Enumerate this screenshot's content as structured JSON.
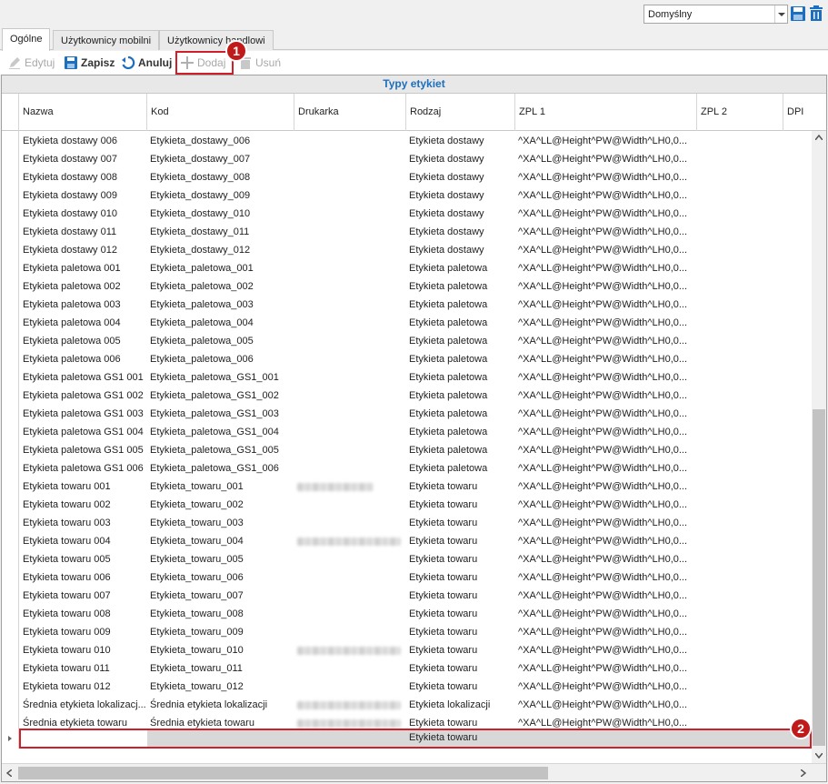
{
  "topbar": {
    "layout_select": "Domyślny",
    "save_icon": "save-layout-icon",
    "delete_icon": "trash-icon"
  },
  "tabs": [
    {
      "label": "Ogólne"
    },
    {
      "label": "Użytkownicy mobilni"
    },
    {
      "label": "Użytkownicy handlowi"
    }
  ],
  "toolbar": {
    "edit": "Edytuj",
    "save": "Zapisz",
    "cancel": "Anuluj",
    "add": "Dodaj",
    "delete": "Usuń"
  },
  "badges": {
    "one": "1",
    "two": "2"
  },
  "grid": {
    "caption": "Typy etykiet",
    "columns": [
      "Nazwa",
      "Kod",
      "Drukarka",
      "Rodzaj",
      "ZPL 1",
      "ZPL 2",
      "DPI"
    ],
    "zpl": "^XA^LL@Height^PW@Width^LH0,0...",
    "rows": [
      {
        "name": "Etykieta dostawy 006",
        "code": "Etykieta_dostawy_006",
        "printer": "",
        "kind": "Etykieta dostawy"
      },
      {
        "name": "Etykieta dostawy 007",
        "code": "Etykieta_dostawy_007",
        "printer": "",
        "kind": "Etykieta dostawy"
      },
      {
        "name": "Etykieta dostawy 008",
        "code": "Etykieta_dostawy_008",
        "printer": "",
        "kind": "Etykieta dostawy"
      },
      {
        "name": "Etykieta dostawy 009",
        "code": "Etykieta_dostawy_009",
        "printer": "",
        "kind": "Etykieta dostawy"
      },
      {
        "name": "Etykieta dostawy 010",
        "code": "Etykieta_dostawy_010",
        "printer": "",
        "kind": "Etykieta dostawy"
      },
      {
        "name": "Etykieta dostawy 011",
        "code": "Etykieta_dostawy_011",
        "printer": "",
        "kind": "Etykieta dostawy"
      },
      {
        "name": "Etykieta dostawy 012",
        "code": "Etykieta_dostawy_012",
        "printer": "",
        "kind": "Etykieta dostawy"
      },
      {
        "name": "Etykieta paletowa 001",
        "code": "Etykieta_paletowa_001",
        "printer": "",
        "kind": "Etykieta paletowa"
      },
      {
        "name": "Etykieta paletowa 002",
        "code": "Etykieta_paletowa_002",
        "printer": "",
        "kind": "Etykieta paletowa"
      },
      {
        "name": "Etykieta paletowa 003",
        "code": "Etykieta_paletowa_003",
        "printer": "",
        "kind": "Etykieta paletowa"
      },
      {
        "name": "Etykieta paletowa 004",
        "code": "Etykieta_paletowa_004",
        "printer": "",
        "kind": "Etykieta paletowa"
      },
      {
        "name": "Etykieta paletowa 005",
        "code": "Etykieta_paletowa_005",
        "printer": "",
        "kind": "Etykieta paletowa"
      },
      {
        "name": "Etykieta paletowa 006",
        "code": "Etykieta_paletowa_006",
        "printer": "",
        "kind": "Etykieta paletowa"
      },
      {
        "name": "Etykieta paletowa GS1 001",
        "code": "Etykieta_paletowa_GS1_001",
        "printer": "",
        "kind": "Etykieta paletowa"
      },
      {
        "name": "Etykieta paletowa GS1 002",
        "code": "Etykieta_paletowa_GS1_002",
        "printer": "",
        "kind": "Etykieta paletowa"
      },
      {
        "name": "Etykieta paletowa GS1 003",
        "code": "Etykieta_paletowa_GS1_003",
        "printer": "",
        "kind": "Etykieta paletowa"
      },
      {
        "name": "Etykieta paletowa GS1 004",
        "code": "Etykieta_paletowa_GS1_004",
        "printer": "",
        "kind": "Etykieta paletowa"
      },
      {
        "name": "Etykieta paletowa GS1 005",
        "code": "Etykieta_paletowa_GS1_005",
        "printer": "",
        "kind": "Etykieta paletowa"
      },
      {
        "name": "Etykieta paletowa GS1 006",
        "code": "Etykieta_paletowa_GS1_006",
        "printer": "",
        "kind": "Etykieta paletowa"
      },
      {
        "name": "Etykieta towaru 001",
        "code": "Etykieta_towaru_001",
        "printer": "redacted-short",
        "kind": "Etykieta towaru"
      },
      {
        "name": "Etykieta towaru 002",
        "code": "Etykieta_towaru_002",
        "printer": "",
        "kind": "Etykieta towaru"
      },
      {
        "name": "Etykieta towaru 003",
        "code": "Etykieta_towaru_003",
        "printer": "",
        "kind": "Etykieta towaru"
      },
      {
        "name": "Etykieta towaru 004",
        "code": "Etykieta_towaru_004",
        "printer": "redacted-long",
        "kind": "Etykieta towaru"
      },
      {
        "name": "Etykieta towaru 005",
        "code": "Etykieta_towaru_005",
        "printer": "",
        "kind": "Etykieta towaru"
      },
      {
        "name": "Etykieta towaru 006",
        "code": "Etykieta_towaru_006",
        "printer": "",
        "kind": "Etykieta towaru"
      },
      {
        "name": "Etykieta towaru 007",
        "code": "Etykieta_towaru_007",
        "printer": "",
        "kind": "Etykieta towaru"
      },
      {
        "name": "Etykieta towaru 008",
        "code": "Etykieta_towaru_008",
        "printer": "",
        "kind": "Etykieta towaru"
      },
      {
        "name": "Etykieta towaru 009",
        "code": "Etykieta_towaru_009",
        "printer": "",
        "kind": "Etykieta towaru"
      },
      {
        "name": "Etykieta towaru 010",
        "code": "Etykieta_towaru_010",
        "printer": "redacted-long",
        "kind": "Etykieta towaru"
      },
      {
        "name": "Etykieta towaru 011",
        "code": "Etykieta_towaru_011",
        "printer": "",
        "kind": "Etykieta towaru"
      },
      {
        "name": "Etykieta towaru 012",
        "code": "Etykieta_towaru_012",
        "printer": "",
        "kind": "Etykieta towaru"
      },
      {
        "name": "Średnia etykieta lokalizacj...",
        "code": "Średnia etykieta lokalizacji",
        "printer": "redacted-long",
        "kind": "Etykieta lokalizacji"
      },
      {
        "name": "Średnia etykieta towaru",
        "code": "Średnia etykieta towaru",
        "printer": "redacted-long",
        "kind": "Etykieta towaru"
      }
    ],
    "new_row": {
      "kind": "Etykieta towaru"
    }
  }
}
